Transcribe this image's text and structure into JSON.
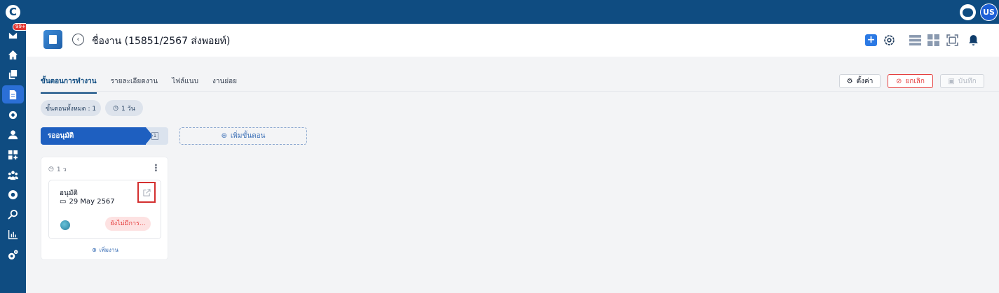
{
  "sidebar": {
    "logo_letter": "C",
    "inbox_badge": "99+",
    "items": [
      "inbox",
      "home",
      "copy",
      "document",
      "settings",
      "user",
      "apps",
      "team",
      "gear",
      "search",
      "chart",
      "cogs"
    ]
  },
  "topbar": {
    "avatar_initials": "US"
  },
  "header": {
    "title": "ชื่องาน (15851/2567 ส่งพอยท์)"
  },
  "tabs": [
    {
      "label": "ขั้นตอนการทำงาน",
      "active": true
    },
    {
      "label": "รายละเอียดงาน",
      "active": false
    },
    {
      "label": "ไฟล์แนบ",
      "active": false
    },
    {
      "label": "งานย่อย",
      "active": false
    }
  ],
  "actions": {
    "settings_label": "ตั้งค่า",
    "cancel_label": "ยกเลิก",
    "save_label": "บันทึก"
  },
  "summary": {
    "steps_total": "ขั้นตอนทั้งหมด : 1",
    "duration": "1 วัน"
  },
  "stage": {
    "name": "รออนุมัติ",
    "count": "1",
    "add_step_label": "เพิ่มขั้นตอน"
  },
  "column": {
    "duration": "1 ว",
    "card": {
      "title": "อนุมัติ",
      "date": "29 May 2567",
      "status": "ยังไม่มีการ..."
    },
    "add_task_label": "เพิ่มงาน"
  },
  "colors": {
    "primary": "#0f4c81",
    "accent": "#2b79e4",
    "danger": "#e53e3e"
  }
}
